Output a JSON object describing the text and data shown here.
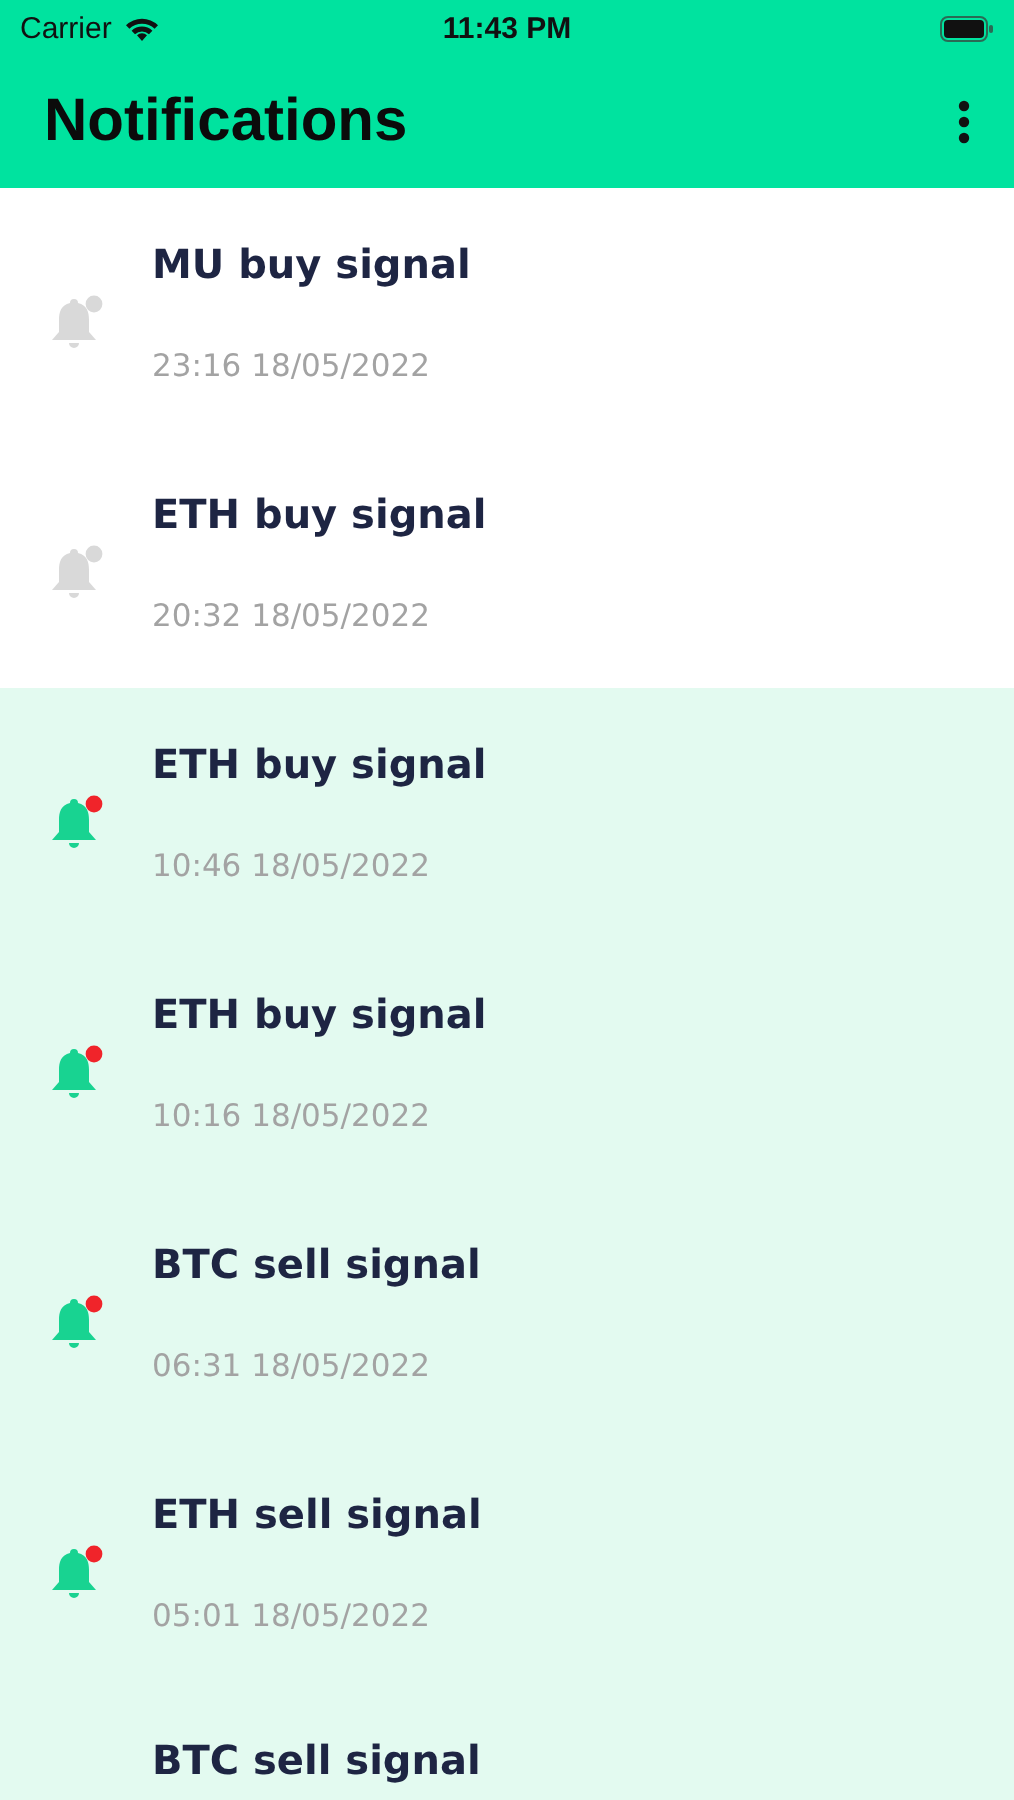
{
  "status_bar": {
    "carrier": "Carrier",
    "time": "11:43 PM"
  },
  "header": {
    "title": "Notifications"
  },
  "notifications": [
    {
      "title": "MU buy signal",
      "time": "23:16 18/05/2022",
      "unread": false
    },
    {
      "title": "ETH buy signal",
      "time": "20:32 18/05/2022",
      "unread": false
    },
    {
      "title": "ETH buy signal",
      "time": "10:46 18/05/2022",
      "unread": true
    },
    {
      "title": "ETH buy signal",
      "time": "10:16 18/05/2022",
      "unread": true
    },
    {
      "title": "BTC sell signal",
      "time": "06:31 18/05/2022",
      "unread": true
    },
    {
      "title": "ETH sell signal",
      "time": "05:01 18/05/2022",
      "unread": true
    },
    {
      "title": "BTC sell signal",
      "unread": true
    }
  ]
}
